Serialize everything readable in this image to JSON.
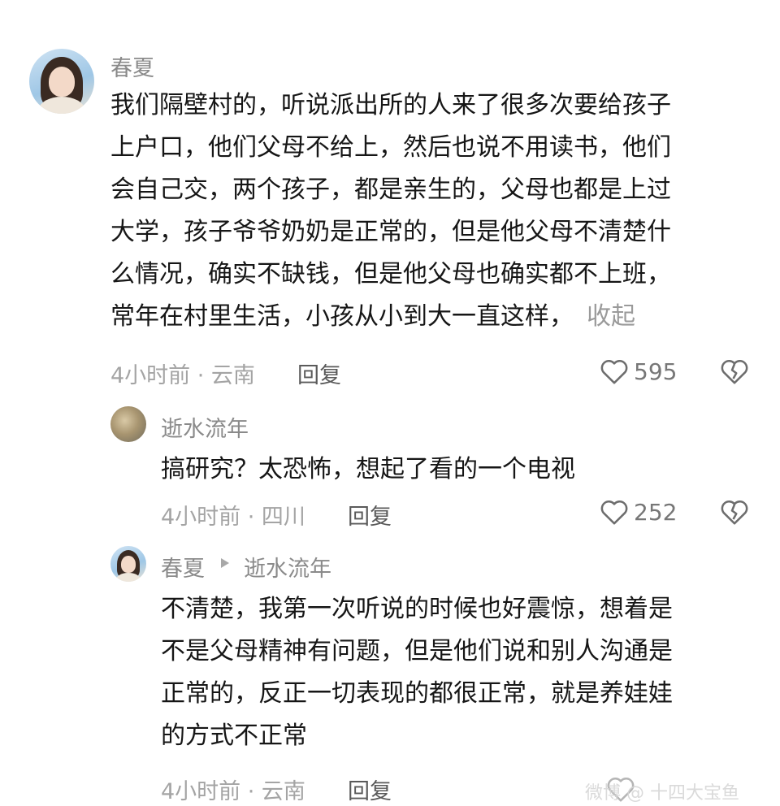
{
  "comments": [
    {
      "username": "春夏",
      "lines": [
        "我们隔壁村的，听说派出所的人来了很多次要给孩子",
        "上户口，他们父母不给上，然后也说不用读书，他们",
        "会自己交，两个孩子，都是亲生的，父母也都是上过",
        "大学，孩子爷爷奶奶是正常的，但是他父母不清楚什",
        "么情况，确实不缺钱，但是他父母也确实都不上班，",
        "常年在村里生活，小孩从小到大一直这样，"
      ],
      "collapse_label": "收起",
      "meta": "4小时前 · 云南",
      "reply_label": "回复",
      "likes": "595"
    },
    {
      "username": "逝水流年",
      "lines": [
        "搞研究？太恐怖，想起了看的一个电视"
      ],
      "meta": "4小时前 · 四川",
      "reply_label": "回复",
      "likes": "252"
    },
    {
      "username": "春夏",
      "reply_to": "逝水流年",
      "lines": [
        "不清楚，我第一次听说的时候也好震惊，想着是",
        "不是父母精神有问题，但是他们说和别人沟通是",
        "正常的，反正一切表现的都很正常，就是养娃娃",
        "的方式不正常"
      ],
      "meta": "4小时前 · 云南",
      "reply_label": "回复"
    }
  ],
  "icons": {
    "like": "heart-outline-icon",
    "dislike": "broken-heart-icon",
    "reply_arrow": "triangle-right-icon"
  },
  "watermark": "微博 @ 十四大宝鱼",
  "colors": {
    "text": "#161616",
    "muted": "#a4a4a4",
    "username": "#8a8a8a"
  }
}
